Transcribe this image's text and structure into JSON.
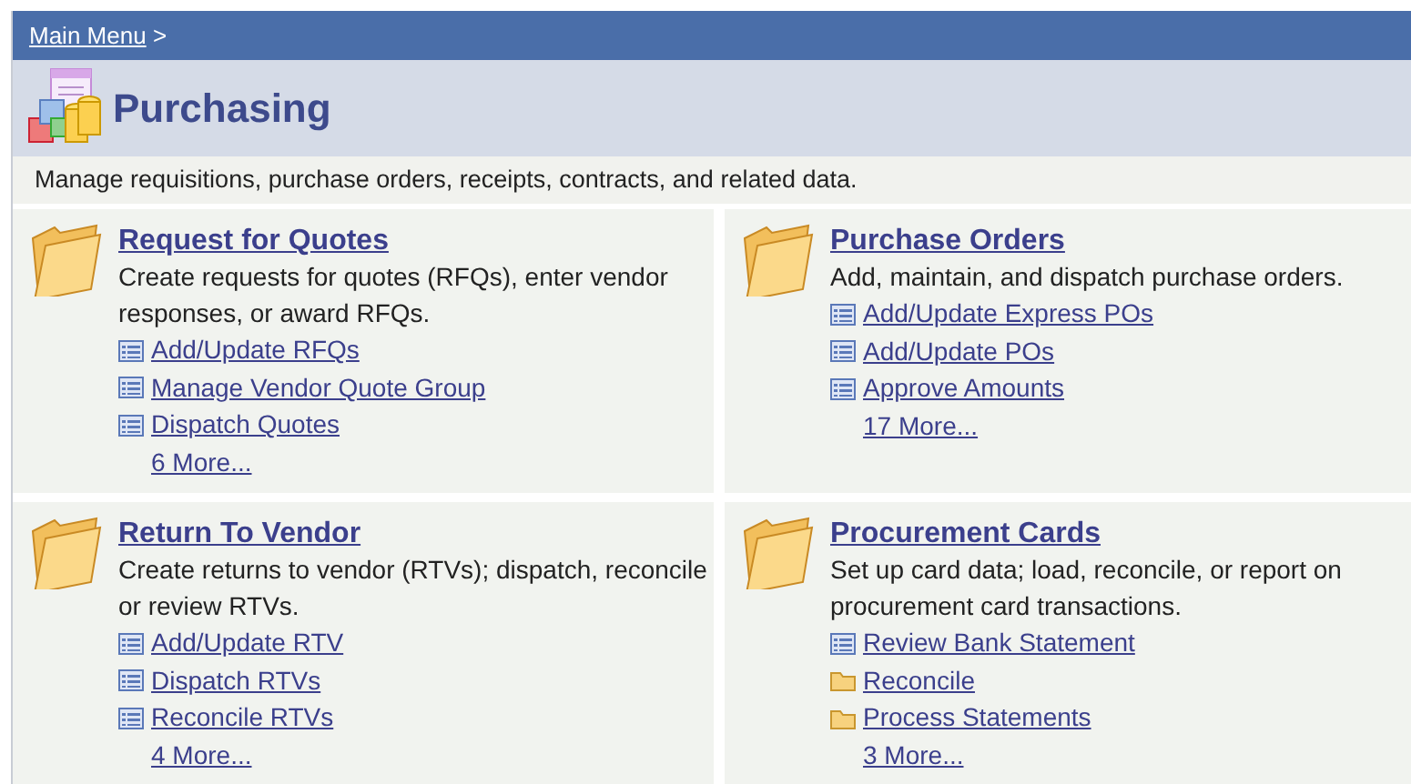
{
  "breadcrumb": {
    "link": "Main Menu",
    "separator": ">"
  },
  "title": "Purchasing",
  "description": "Manage requisitions, purchase orders, receipts, contracts, and related data.",
  "sections": [
    {
      "title": "Request for Quotes",
      "description": "Create requests for quotes (RFQs), enter vendor responses, or award RFQs.",
      "items": [
        {
          "label": "Add/Update RFQs",
          "kind": "page"
        },
        {
          "label": "Manage Vendor Quote Group",
          "kind": "page"
        },
        {
          "label": "Dispatch Quotes",
          "kind": "page"
        }
      ],
      "more": "6 More..."
    },
    {
      "title": "Purchase Orders",
      "description": "Add, maintain, and dispatch purchase orders.",
      "items": [
        {
          "label": "Add/Update Express POs",
          "kind": "page"
        },
        {
          "label": "Add/Update POs",
          "kind": "page"
        },
        {
          "label": "Approve Amounts",
          "kind": "page"
        }
      ],
      "more": "17 More..."
    },
    {
      "title": "Return To Vendor",
      "description": "Create returns to vendor (RTVs); dispatch, reconcile or review RTVs.",
      "items": [
        {
          "label": "Add/Update RTV",
          "kind": "page"
        },
        {
          "label": "Dispatch RTVs",
          "kind": "page"
        },
        {
          "label": "Reconcile RTVs",
          "kind": "page"
        }
      ],
      "more": "4 More..."
    },
    {
      "title": "Procurement Cards",
      "description": "Set up card data; load, reconcile, or report on procurement card transactions.",
      "items": [
        {
          "label": "Review Bank Statement",
          "kind": "page"
        },
        {
          "label": "Reconcile",
          "kind": "folder"
        },
        {
          "label": "Process Statements",
          "kind": "folder"
        }
      ],
      "more": "3 More..."
    }
  ]
}
